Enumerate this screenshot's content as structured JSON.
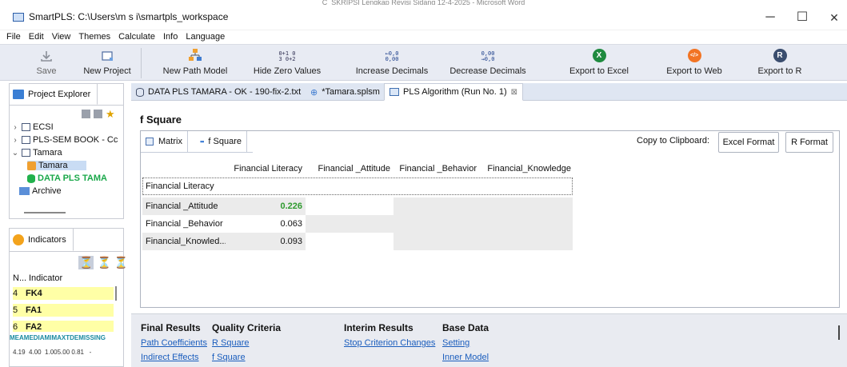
{
  "window": {
    "background_text": "C_SKRIPSI Lengkap Revisi Sidang 12-4-2025 - Microsoft Word",
    "title": "SmartPLS: C:\\Users\\m s i\\smartpls_workspace",
    "minimize": "─",
    "maximize": "☐",
    "close": "✕"
  },
  "menu": [
    "File",
    "Edit",
    "View",
    "Themes",
    "Calculate",
    "Info",
    "Language"
  ],
  "toolbar": {
    "save": "Save",
    "new_project": "New Project",
    "new_path_model": "New Path Model",
    "hide_zero": "Hide Zero Values",
    "hide_zero_icon_top": "0+1 0",
    "hide_zero_icon_bot": "3 0+2",
    "increase_decimals": "Increase Decimals",
    "increase_icon_top": "←0,0",
    "increase_icon_bot": "0,00",
    "decrease_decimals": "Decrease Decimals",
    "decrease_icon_top": "0,00",
    "decrease_icon_bot": "→0,0",
    "export_excel": "Export to Excel",
    "export_web": "Export to Web",
    "export_r": "Export to R",
    "excel_glyph": "X",
    "web_glyph": "</>",
    "r_glyph": "R"
  },
  "project_explorer": {
    "tab": "Project Explorer",
    "items": {
      "ecsi": "ECSI",
      "book": "PLS-SEM BOOK - Cc",
      "tamara_folder": "Tamara",
      "tamara_model": "Tamara",
      "data": "DATA PLS TAMA",
      "archive": "Archive"
    }
  },
  "indicators": {
    "tab": "Indicators",
    "col_n": "N...",
    "col_indicator": "Indicator",
    "rows": [
      {
        "n": "4",
        "name": "FK4"
      },
      {
        "n": "5",
        "name": "FA1"
      },
      {
        "n": "6",
        "name": "FA2"
      }
    ],
    "stats_header": "MEAMEDIAMIMAXTDEMISSING",
    "stats_values": "4.19  4.00  1.005.00 0.81   -"
  },
  "editor_tabs": [
    {
      "label": "DATA PLS TAMARA - OK - 190-fix-2.txt"
    },
    {
      "label": "*Tamara.splsm"
    },
    {
      "label": "PLS Algorithm (Run No. 1)",
      "close": "⊠"
    }
  ],
  "report": {
    "title": "f Square",
    "subtabs": {
      "matrix": "Matrix",
      "fsquare": "f Square"
    },
    "copy_label": "Copy to Clipboard:",
    "excel_format": "Excel Format",
    "r_format": "R Format",
    "columns": [
      "Financial Literacy",
      "Financial _Attitude",
      "Financial _Behavior",
      "Financial_Knowledge"
    ],
    "rows": [
      {
        "label": "Financial Literacy",
        "values": [
          "",
          "",
          "",
          ""
        ]
      },
      {
        "label": "Financial _Attitude",
        "values": [
          "0.226",
          "",
          "",
          ""
        ]
      },
      {
        "label": "Financial _Behavior",
        "values": [
          "0.063",
          "",
          "",
          ""
        ]
      },
      {
        "label": "Financial_Knowled...",
        "values": [
          "0.093",
          "",
          "",
          ""
        ]
      }
    ],
    "highlight_color": "#2e9a2e"
  },
  "bottom": {
    "final_results": "Final Results",
    "path_coefficients": "Path Coefficients",
    "indirect_effects": "Indirect Effects",
    "quality_criteria": "Quality Criteria",
    "r_square": "R Square",
    "f_square": "f Square",
    "interim_results": "Interim Results",
    "stop_criterion": "Stop Criterion Changes",
    "base_data": "Base Data",
    "setting": "Setting",
    "inner_model": "Inner Model"
  },
  "colors": {
    "link": "#1a5dbd",
    "toolbar_bg": "#e8ebf3",
    "indicator_highlight": "#ffffa6"
  }
}
